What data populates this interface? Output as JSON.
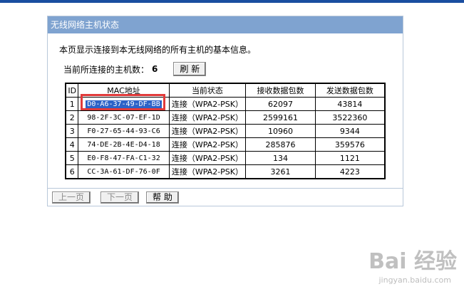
{
  "window": {
    "title": "无线网络主机状态"
  },
  "description": "本页显示连接到本无线网络的所有主机的基本信息。",
  "host_count": {
    "label": "当前所连接的主机数：",
    "value": "6"
  },
  "refresh_button": "刷 新",
  "table": {
    "headers": [
      "ID",
      "MAC地址",
      "当前状态",
      "接收数据包数",
      "发送数据包数"
    ],
    "rows": [
      {
        "id": "1",
        "mac": "D0-A6-37-49-DF-BB",
        "status": "连接（WPA2-PSK）",
        "rx": "62097",
        "tx": "43814"
      },
      {
        "id": "2",
        "mac": "98-2F-3C-07-EF-1D",
        "status": "连接（WPA2-PSK）",
        "rx": "2599161",
        "tx": "3522360"
      },
      {
        "id": "3",
        "mac": "F0-27-65-44-93-C6",
        "status": "连接（WPA2-PSK）",
        "rx": "10960",
        "tx": "9344"
      },
      {
        "id": "4",
        "mac": "74-DE-2B-4E-D4-18",
        "status": "连接（WPA2-PSK）",
        "rx": "285876",
        "tx": "359576"
      },
      {
        "id": "5",
        "mac": "E0-F8-47-FA-C1-32",
        "status": "连接（WPA2-PSK）",
        "rx": "134",
        "tx": "1121"
      },
      {
        "id": "6",
        "mac": "CC-3A-61-DF-76-0F",
        "status": "连接（WPA2-PSK）",
        "rx": "3261",
        "tx": "4223"
      }
    ]
  },
  "footer": {
    "prev": "上一页",
    "next": "下一页",
    "help": "帮 助"
  },
  "watermark": {
    "logo": "Bai 经验",
    "url": "jingyan.baidu.com"
  },
  "colors": {
    "header_bar": "#7fa3d0",
    "top_bar": "#1a4ea0",
    "highlight": "#2d63c8",
    "callout": "#e03a3a"
  }
}
